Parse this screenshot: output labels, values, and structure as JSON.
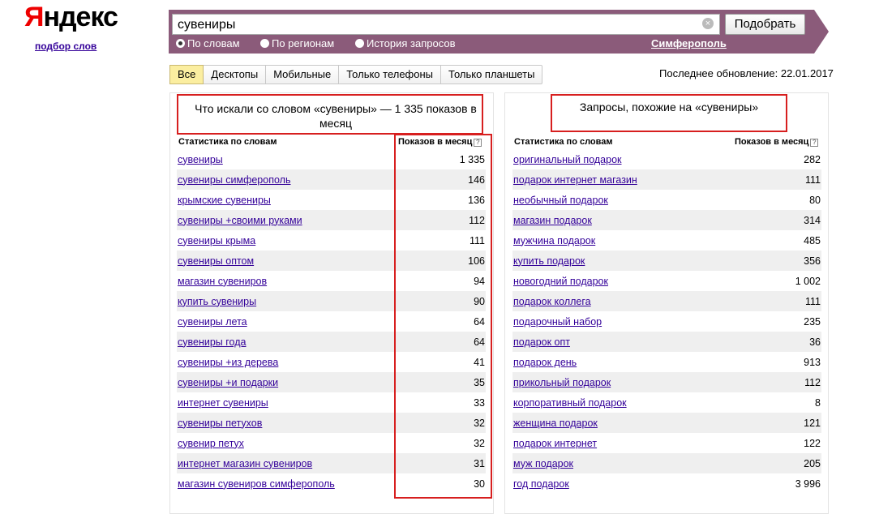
{
  "logo": {
    "first": "Я",
    "rest": "ндекс",
    "sub": "подбор слов"
  },
  "search": {
    "value": "сувениры",
    "submit_label": "Подобрать",
    "clear_icon": "×"
  },
  "options": [
    {
      "label": "По словам",
      "selected": true
    },
    {
      "label": "По регионам",
      "selected": false
    },
    {
      "label": "История запросов",
      "selected": false
    }
  ],
  "region": "Симферополь",
  "tabs": [
    {
      "label": "Все",
      "active": true
    },
    {
      "label": "Десктопы",
      "active": false
    },
    {
      "label": "Мобильные",
      "active": false
    },
    {
      "label": "Только телефоны",
      "active": false
    },
    {
      "label": "Только планшеты",
      "active": false
    }
  ],
  "last_update": "Последнее обновление: 22.01.2017",
  "left": {
    "title": "Что искали со словом «сувениры» — 1 335 показов в месяц",
    "col_keyword": "Статистика по словам",
    "col_count": "Показов в месяц",
    "help_icon": "?",
    "rows": [
      {
        "kw": "сувениры",
        "n": "1 335"
      },
      {
        "kw": "сувениры симферополь",
        "n": "146"
      },
      {
        "kw": "крымские сувениры",
        "n": "136"
      },
      {
        "kw": "сувениры +своими руками",
        "n": "112"
      },
      {
        "kw": "сувениры крыма",
        "n": "111"
      },
      {
        "kw": "сувениры оптом",
        "n": "106"
      },
      {
        "kw": "магазин сувениров",
        "n": "94"
      },
      {
        "kw": "купить сувениры",
        "n": "90"
      },
      {
        "kw": "сувениры лета",
        "n": "64"
      },
      {
        "kw": "сувениры года",
        "n": "64"
      },
      {
        "kw": "сувениры +из дерева",
        "n": "41"
      },
      {
        "kw": "сувениры +и подарки",
        "n": "35"
      },
      {
        "kw": "интернет сувениры",
        "n": "33"
      },
      {
        "kw": "сувениры петухов",
        "n": "32"
      },
      {
        "kw": "сувенир петух",
        "n": "32"
      },
      {
        "kw": "интернет магазин сувениров",
        "n": "31"
      },
      {
        "kw": "магазин сувениров симферополь",
        "n": "30"
      }
    ]
  },
  "right": {
    "title": "Запросы, похожие на «сувениры»",
    "col_keyword": "Статистика по словам",
    "col_count": "Показов в месяц",
    "help_icon": "?",
    "rows": [
      {
        "kw": "оригинальный подарок",
        "n": "282"
      },
      {
        "kw": "подарок интернет магазин",
        "n": "111"
      },
      {
        "kw": "необычный подарок",
        "n": "80"
      },
      {
        "kw": "магазин подарок",
        "n": "314"
      },
      {
        "kw": "мужчина подарок",
        "n": "485"
      },
      {
        "kw": "купить подарок",
        "n": "356"
      },
      {
        "kw": "новогодний подарок",
        "n": "1 002"
      },
      {
        "kw": "подарок коллега",
        "n": "111"
      },
      {
        "kw": "подарочный набор",
        "n": "235"
      },
      {
        "kw": "подарок опт",
        "n": "36"
      },
      {
        "kw": "подарок день",
        "n": "913"
      },
      {
        "kw": "прикольный подарок",
        "n": "112"
      },
      {
        "kw": "корпоративный подарок",
        "n": "8"
      },
      {
        "kw": "женщина подарок",
        "n": "121"
      },
      {
        "kw": "подарок интернет",
        "n": "122"
      },
      {
        "kw": "муж подарок",
        "n": "205"
      },
      {
        "kw": "год подарок",
        "n": "3 996"
      }
    ]
  },
  "colors": {
    "accent": "#8b5b7a",
    "highlight": "#d71f1f",
    "link": "#330099"
  }
}
